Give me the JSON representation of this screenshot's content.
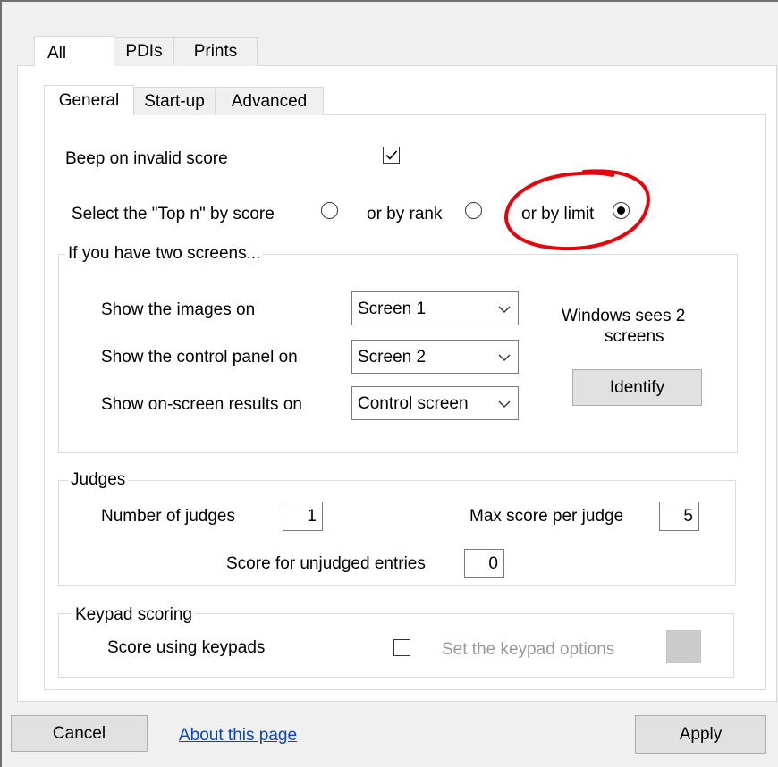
{
  "outer_tabs": [
    {
      "label": "All",
      "active": true
    },
    {
      "label": "PDIs",
      "active": false
    },
    {
      "label": "Prints",
      "active": false
    }
  ],
  "inner_tabs": [
    {
      "label": "General",
      "active": true
    },
    {
      "label": "Start-up",
      "active": false
    },
    {
      "label": "Advanced",
      "active": false
    }
  ],
  "general": {
    "beep_label": "Beep on invalid score",
    "beep_checked": true,
    "top_n_label": "Select the \"Top n\" by score",
    "by_rank_label": "or by rank",
    "by_limit_label": "or by limit",
    "selected_option": "limit"
  },
  "screens": {
    "legend": "If you have two screens...",
    "images_label": "Show the images on",
    "images_value": "Screen 1",
    "control_label": "Show the control panel on",
    "control_value": "Screen 2",
    "results_label": "Show on-screen results on",
    "results_value": "Control screen",
    "windows_info_line1": "Windows sees 2",
    "windows_info_line2": "screens",
    "identify_label": "Identify"
  },
  "judges": {
    "legend": "Judges",
    "number_label": "Number of judges",
    "number_value": "1",
    "max_label": "Max score per judge",
    "max_value": "5",
    "unjudged_label": "Score for unjudged entries",
    "unjudged_value": "0"
  },
  "keypad": {
    "legend": "Keypad scoring",
    "using_label": "Score using keypads",
    "using_checked": false,
    "options_label": "Set the keypad options"
  },
  "footer": {
    "cancel_label": "Cancel",
    "about_label": "About this page",
    "apply_label": "Apply"
  },
  "colors": {
    "annotation": "#e8000b",
    "link": "#0645c6"
  }
}
